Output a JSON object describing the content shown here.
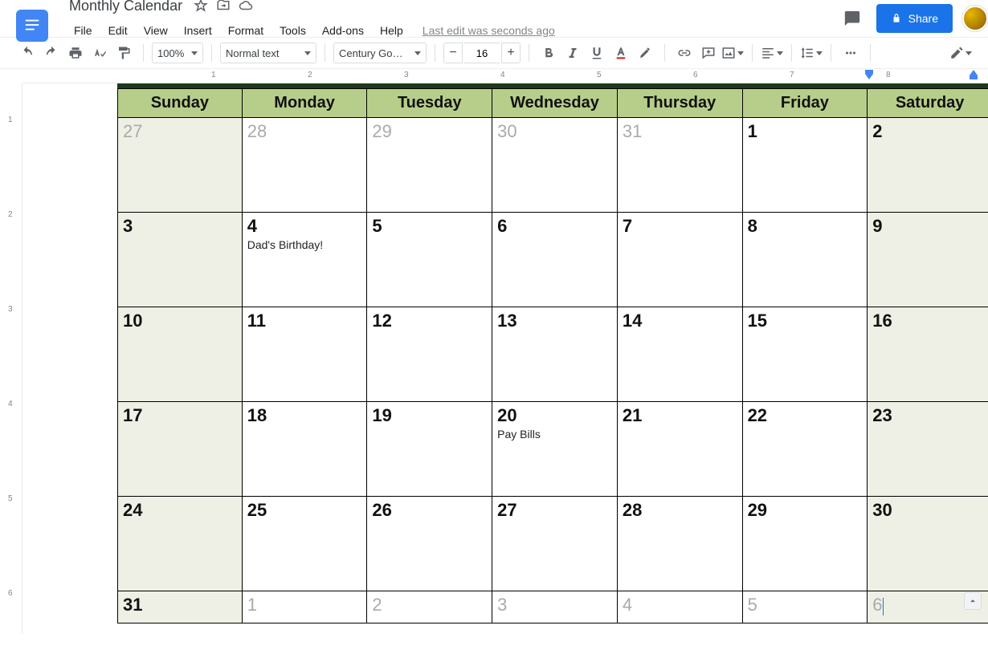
{
  "app": {
    "document_title": "Monthly Calendar",
    "last_edit": "Last edit was seconds ago"
  },
  "menu": {
    "items": [
      "File",
      "Edit",
      "View",
      "Insert",
      "Format",
      "Tools",
      "Add-ons",
      "Help"
    ]
  },
  "toolbar": {
    "zoom": "100%",
    "paragraph_style": "Normal text",
    "font": "Century Go…",
    "font_size": "16"
  },
  "share": {
    "label": "Share"
  },
  "calendar": {
    "day_headers": [
      "Sunday",
      "Monday",
      "Tuesday",
      "Wednesday",
      "Thursday",
      "Friday",
      "Saturday"
    ],
    "rows": [
      [
        {
          "n": "27",
          "other": true,
          "wk": true
        },
        {
          "n": "28",
          "other": true
        },
        {
          "n": "29",
          "other": true
        },
        {
          "n": "30",
          "other": true
        },
        {
          "n": "31",
          "other": true
        },
        {
          "n": "1"
        },
        {
          "n": "2",
          "wk": true
        }
      ],
      [
        {
          "n": "3",
          "wk": true
        },
        {
          "n": "4",
          "evt": "Dad's Birthday!"
        },
        {
          "n": "5"
        },
        {
          "n": "6"
        },
        {
          "n": "7"
        },
        {
          "n": "8"
        },
        {
          "n": "9",
          "wk": true
        }
      ],
      [
        {
          "n": "10",
          "wk": true
        },
        {
          "n": "11"
        },
        {
          "n": "12"
        },
        {
          "n": "13"
        },
        {
          "n": "14"
        },
        {
          "n": "15"
        },
        {
          "n": "16",
          "wk": true
        }
      ],
      [
        {
          "n": "17",
          "wk": true
        },
        {
          "n": "18"
        },
        {
          "n": "19"
        },
        {
          "n": "20",
          "evt": "Pay Bills"
        },
        {
          "n": "21"
        },
        {
          "n": "22"
        },
        {
          "n": "23",
          "wk": true
        }
      ],
      [
        {
          "n": "24",
          "wk": true
        },
        {
          "n": "25"
        },
        {
          "n": "26"
        },
        {
          "n": "27"
        },
        {
          "n": "28"
        },
        {
          "n": "29"
        },
        {
          "n": "30",
          "wk": true
        }
      ],
      [
        {
          "n": "31",
          "wk": true
        },
        {
          "n": "1",
          "other": true
        },
        {
          "n": "2",
          "other": true
        },
        {
          "n": "3",
          "other": true
        },
        {
          "n": "4",
          "other": true
        },
        {
          "n": "5",
          "other": true
        },
        {
          "n": "6",
          "other": true,
          "wk": true,
          "cursor": true
        }
      ]
    ]
  },
  "ruler": {
    "h": [
      1,
      2,
      3,
      4,
      5,
      6,
      7,
      8
    ],
    "v": [
      1,
      2,
      3,
      4,
      5,
      6
    ]
  }
}
